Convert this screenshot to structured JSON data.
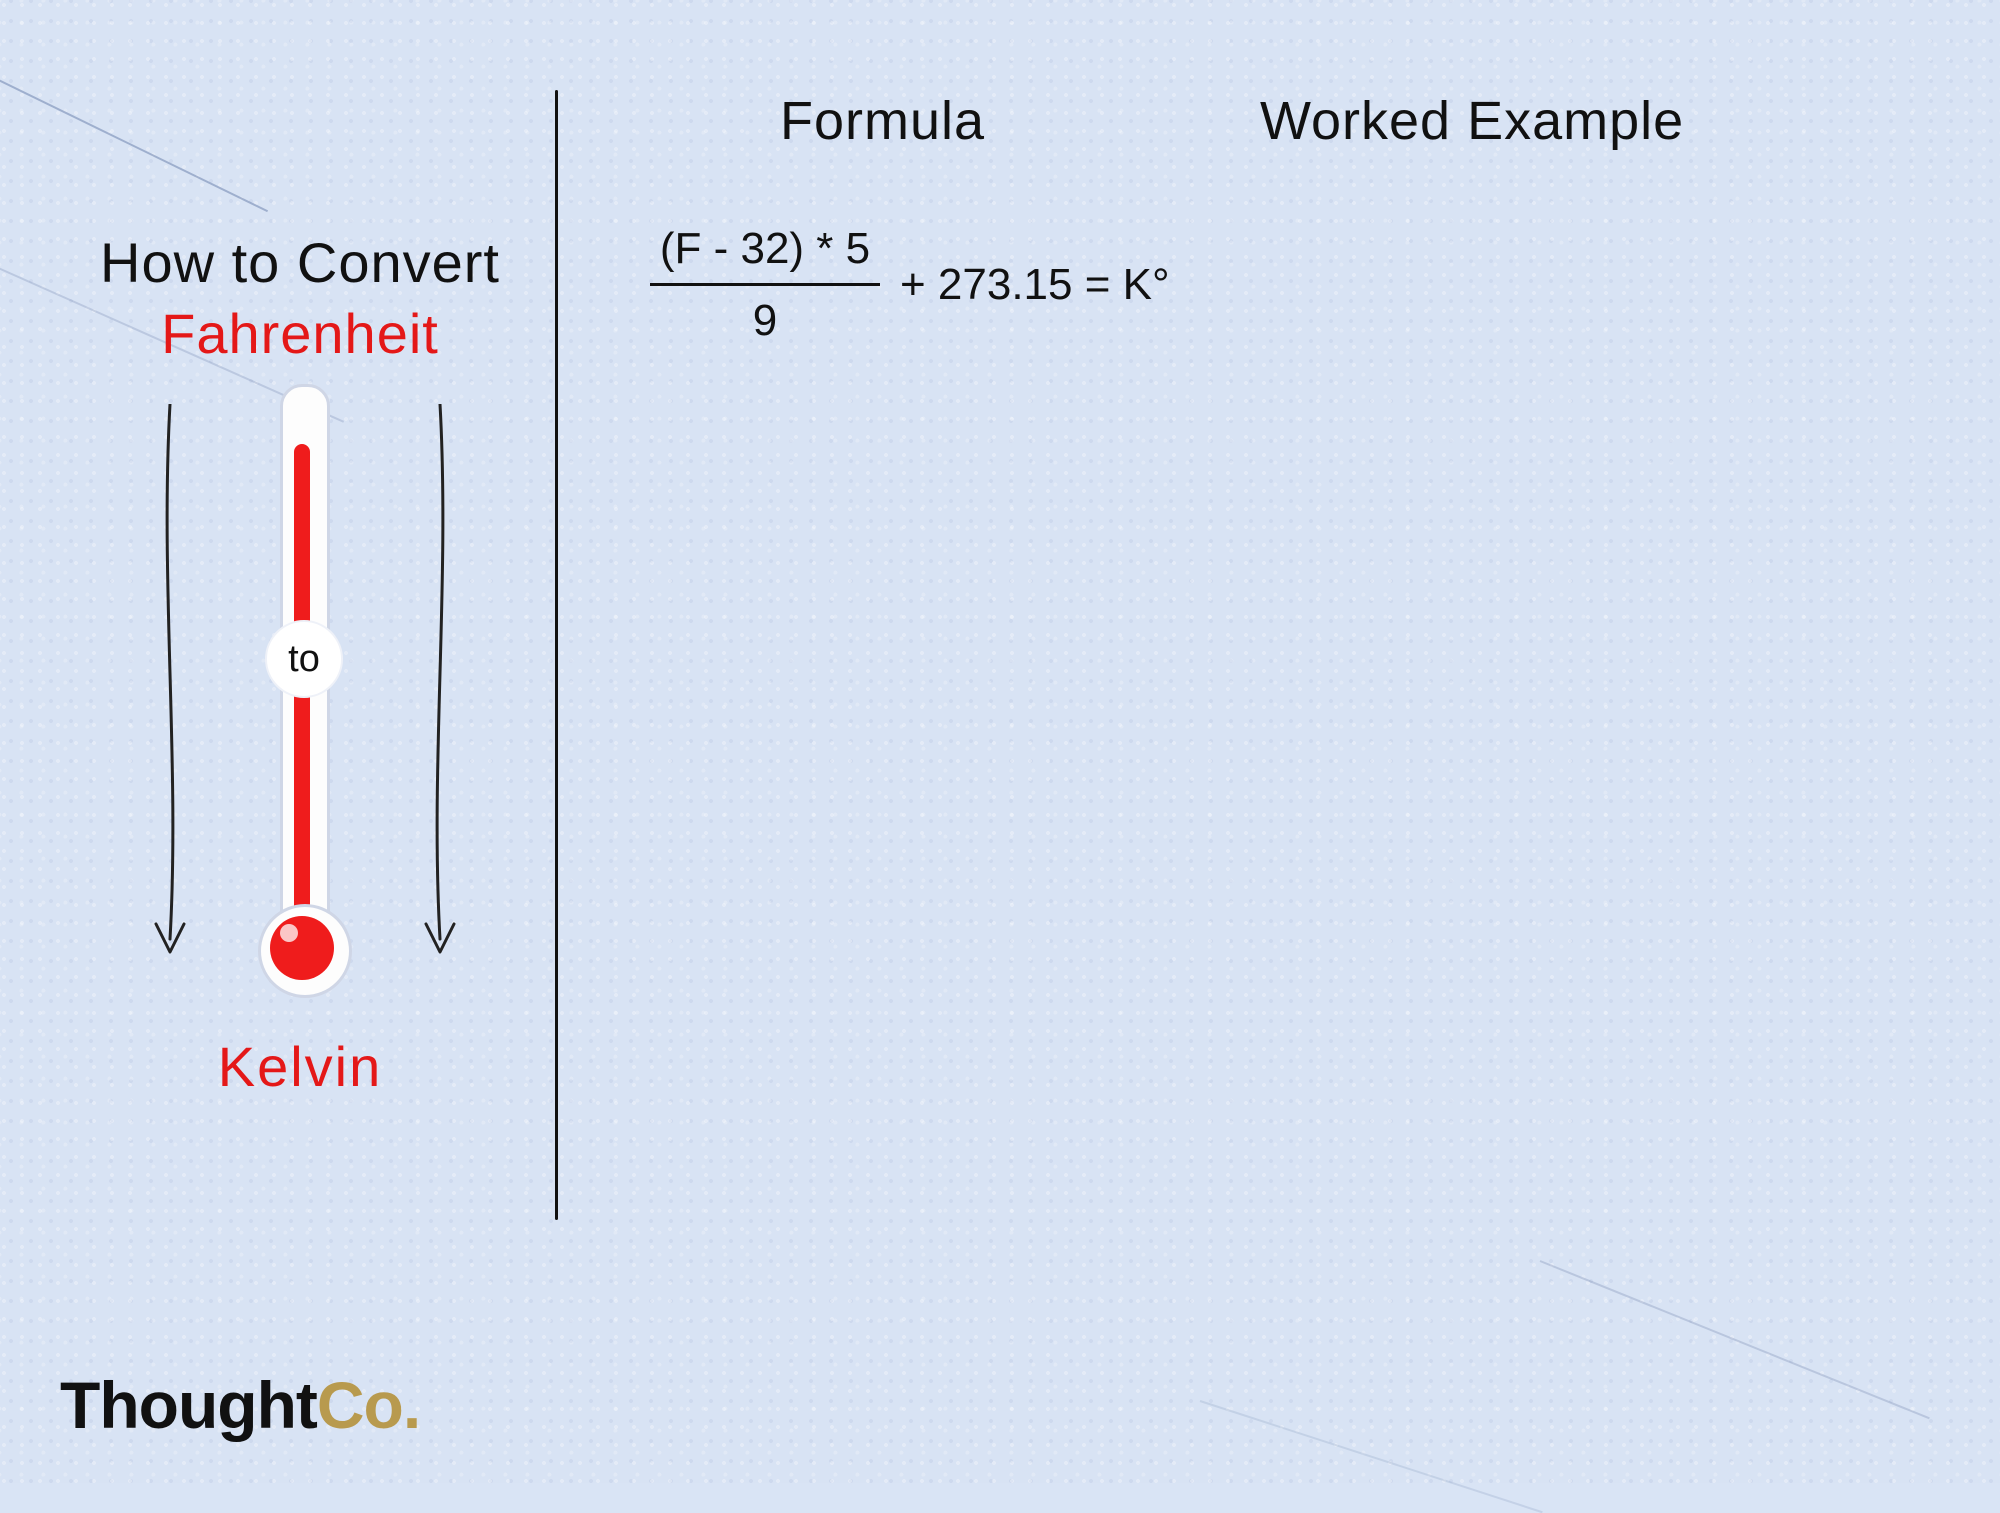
{
  "left": {
    "title_line1": "How to Convert",
    "unit_from": "Fahrenheit",
    "to_word": "to",
    "unit_to": "Kelvin"
  },
  "headings": {
    "formula": "Formula",
    "worked_example": "Worked Example"
  },
  "formula": {
    "numerator": "(F - 32) * 5",
    "denominator": "9",
    "tail": "+ 273.15 = K°"
  },
  "logo": {
    "part1": "Thought",
    "part2": "Co."
  }
}
